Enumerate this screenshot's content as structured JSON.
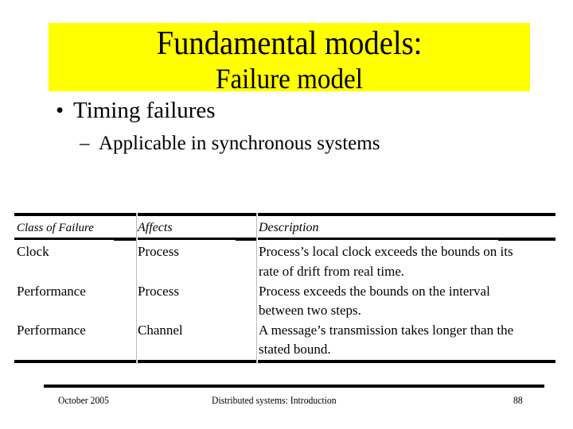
{
  "slide": {
    "title_line1": "Fundamental models:",
    "title_line2": "Failure model",
    "title_bg_color": "#ffff00",
    "bullets": [
      {
        "level": 1,
        "marker": "•",
        "text": "Timing failures"
      },
      {
        "level": 2,
        "marker": "–",
        "text": "Applicable in synchronous systems"
      }
    ]
  },
  "table": {
    "headers": [
      "Class of Failure",
      "Affects",
      "Description"
    ],
    "rows": [
      {
        "class": "Clock",
        "affects": "Process",
        "description": [
          "Process’s local clock exceeds the bounds on its",
          "rate of drift from real time."
        ]
      },
      {
        "class": "Performance",
        "affects": "Process",
        "description": [
          "Process exceeds the bounds on the interval",
          "between two steps."
        ]
      },
      {
        "class": "Performance",
        "affects": "Channel",
        "description": [
          "A message’s transmission takes longer than the",
          "stated bound."
        ]
      }
    ]
  },
  "footer": {
    "date": "October 2005",
    "course": "Distributed systems: Introduction",
    "page": "88"
  }
}
